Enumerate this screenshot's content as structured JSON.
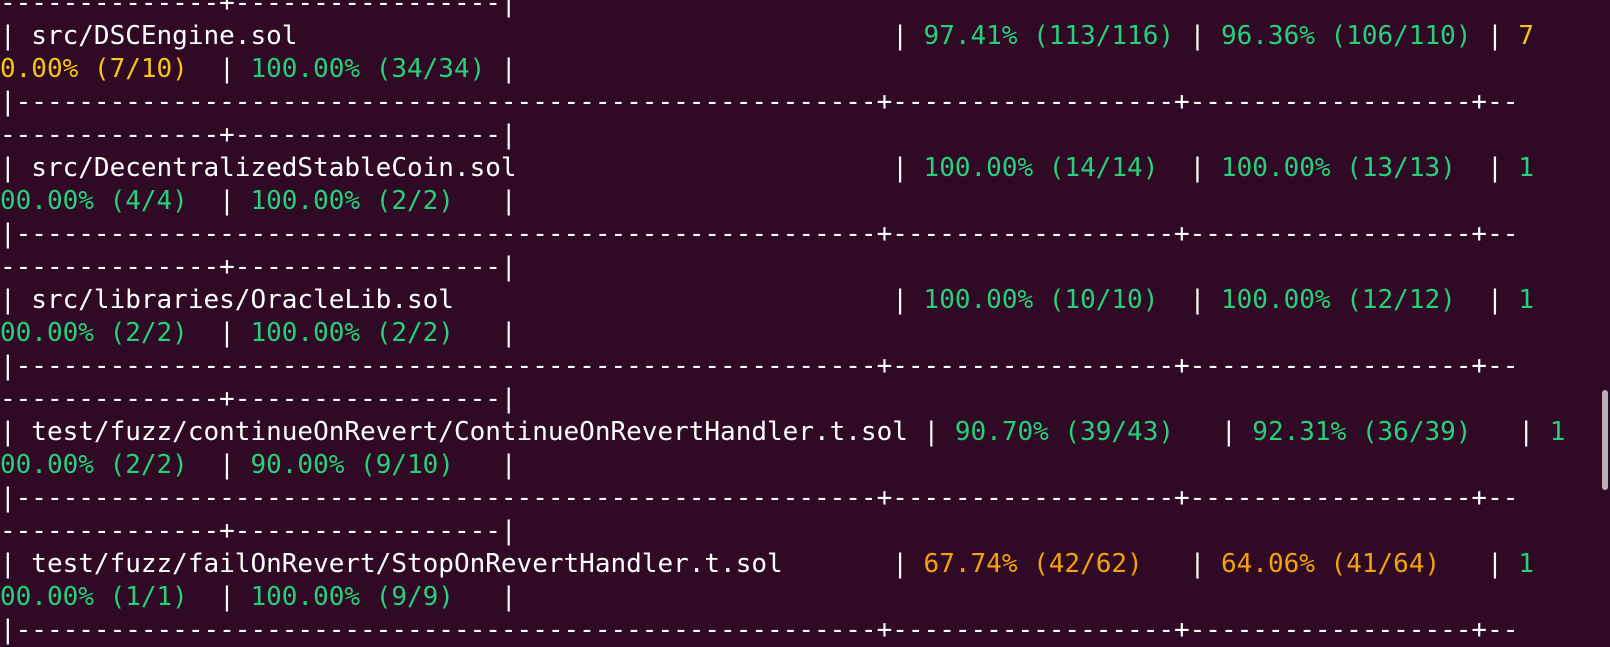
{
  "colors": {
    "background": "#300a24",
    "text": "#ffffff",
    "good": "#26d07c",
    "warn": "#f5c518",
    "medium": "#f2a20a"
  },
  "lines": [
    [
      {
        "t": "--------------+-----------------|",
        "c": "white"
      }
    ],
    [
      {
        "t": "| src/DSCEngine.sol                                      | ",
        "c": "white"
      },
      {
        "t": "97.41% (113/116)",
        "c": "green"
      },
      {
        "t": " | ",
        "c": "white"
      },
      {
        "t": "96.36% (106/110)",
        "c": "green"
      },
      {
        "t": " | ",
        "c": "white"
      },
      {
        "t": "7",
        "c": "yellow"
      }
    ],
    [
      {
        "t": "0.00% (7/10)",
        "c": "yellow"
      },
      {
        "t": "  | ",
        "c": "white"
      },
      {
        "t": "100.00% (34/34)",
        "c": "green"
      },
      {
        "t": " |",
        "c": "white"
      }
    ],
    [
      {
        "t": "|-------------------------------------------------------+------------------+------------------+--",
        "c": "white"
      }
    ],
    [
      {
        "t": "--------------+-----------------|",
        "c": "white"
      }
    ],
    [
      {
        "t": "| src/DecentralizedStableCoin.sol                        | ",
        "c": "white"
      },
      {
        "t": "100.00% (14/14)",
        "c": "green"
      },
      {
        "t": "  | ",
        "c": "white"
      },
      {
        "t": "100.00% (13/13)",
        "c": "green"
      },
      {
        "t": "  | ",
        "c": "white"
      },
      {
        "t": "1",
        "c": "green"
      }
    ],
    [
      {
        "t": "00.00% (4/4)",
        "c": "green"
      },
      {
        "t": "  | ",
        "c": "white"
      },
      {
        "t": "100.00% (2/2)",
        "c": "green"
      },
      {
        "t": "   |",
        "c": "white"
      }
    ],
    [
      {
        "t": "|-------------------------------------------------------+------------------+------------------+--",
        "c": "white"
      }
    ],
    [
      {
        "t": "--------------+-----------------|",
        "c": "white"
      }
    ],
    [
      {
        "t": "| src/libraries/OracleLib.sol                            | ",
        "c": "white"
      },
      {
        "t": "100.00% (10/10)",
        "c": "green"
      },
      {
        "t": "  | ",
        "c": "white"
      },
      {
        "t": "100.00% (12/12)",
        "c": "green"
      },
      {
        "t": "  | ",
        "c": "white"
      },
      {
        "t": "1",
        "c": "green"
      }
    ],
    [
      {
        "t": "00.00% (2/2)",
        "c": "green"
      },
      {
        "t": "  | ",
        "c": "white"
      },
      {
        "t": "100.00% (2/2)",
        "c": "green"
      },
      {
        "t": "   |",
        "c": "white"
      }
    ],
    [
      {
        "t": "|-------------------------------------------------------+------------------+------------------+--",
        "c": "white"
      }
    ],
    [
      {
        "t": "--------------+-----------------|",
        "c": "white"
      }
    ],
    [
      {
        "t": "| test/fuzz/continueOnRevert/ContinueOnRevertHandler.t.sol | ",
        "c": "white"
      },
      {
        "t": "90.70% (39/43)",
        "c": "green"
      },
      {
        "t": "   | ",
        "c": "white"
      },
      {
        "t": "92.31% (36/39)",
        "c": "green"
      },
      {
        "t": "   | ",
        "c": "white"
      },
      {
        "t": "1",
        "c": "green"
      }
    ],
    [
      {
        "t": "00.00% (2/2)",
        "c": "green"
      },
      {
        "t": "  | ",
        "c": "white"
      },
      {
        "t": "90.00% (9/10)",
        "c": "green"
      },
      {
        "t": "   |",
        "c": "white"
      }
    ],
    [
      {
        "t": "|-------------------------------------------------------+------------------+------------------+--",
        "c": "white"
      }
    ],
    [
      {
        "t": "--------------+-----------------|",
        "c": "white"
      }
    ],
    [
      {
        "t": "| test/fuzz/failOnRevert/StopOnRevertHandler.t.sol       | ",
        "c": "white"
      },
      {
        "t": "67.74% (42/62)",
        "c": "orange"
      },
      {
        "t": "   | ",
        "c": "white"
      },
      {
        "t": "64.06% (41/64)",
        "c": "orange"
      },
      {
        "t": "   | ",
        "c": "white"
      },
      {
        "t": "1",
        "c": "green"
      }
    ],
    [
      {
        "t": "00.00% (1/1)",
        "c": "green"
      },
      {
        "t": "  | ",
        "c": "white"
      },
      {
        "t": "100.00% (9/9)",
        "c": "green"
      },
      {
        "t": "   |",
        "c": "white"
      }
    ],
    [
      {
        "t": "|-------------------------------------------------------+------------------+------------------+--",
        "c": "white"
      }
    ]
  ]
}
